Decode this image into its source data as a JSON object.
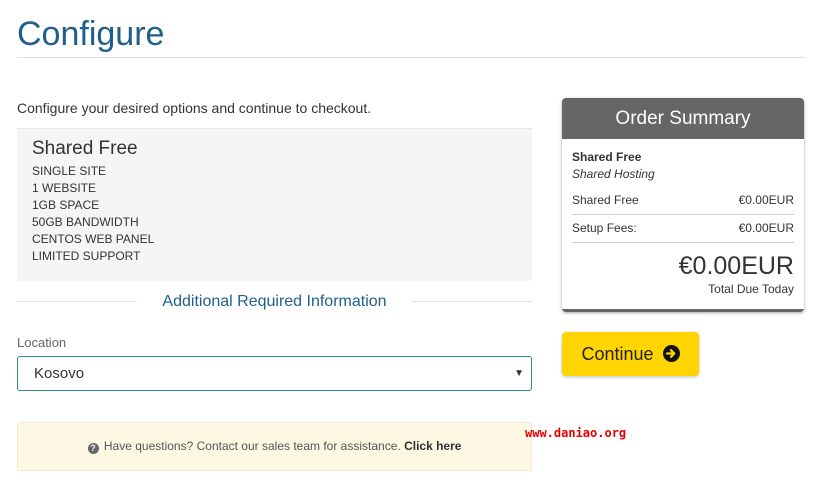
{
  "page": {
    "title": "Configure",
    "intro": "Configure your desired options and continue to checkout."
  },
  "product": {
    "name": "Shared Free",
    "features": [
      "SINGLE SITE",
      "1 WEBSITE",
      "1GB SPACE",
      "50GB BANDWIDTH",
      "CENTOS WEB PANEL",
      "LIMITED SUPPORT"
    ]
  },
  "additional": {
    "heading": "Additional Required Information",
    "location_label": "Location",
    "location_value": "Kosovo"
  },
  "help": {
    "text": "Have questions? Contact our sales team for assistance.",
    "link": "Click here"
  },
  "watermark": "www.daniao.org",
  "summary": {
    "header": "Order Summary",
    "product_name": "Shared Free",
    "product_group": "Shared Hosting",
    "rows": [
      {
        "label": "Shared Free",
        "value": "€0.00EUR"
      },
      {
        "label": "Setup Fees:",
        "value": "€0.00EUR"
      }
    ],
    "total": "€0.00EUR",
    "total_label": "Total Due Today"
  },
  "actions": {
    "continue_label": "Continue"
  },
  "icons": {
    "help": "question-circle-icon",
    "continue": "arrow-circle-right-icon",
    "select": "caret-down-icon"
  },
  "colors": {
    "title": "#1f5f8c",
    "summary_header": "#666666",
    "continue_button": "#ffd400",
    "help_background": "#fcf8e3",
    "watermark": "#e60000"
  }
}
